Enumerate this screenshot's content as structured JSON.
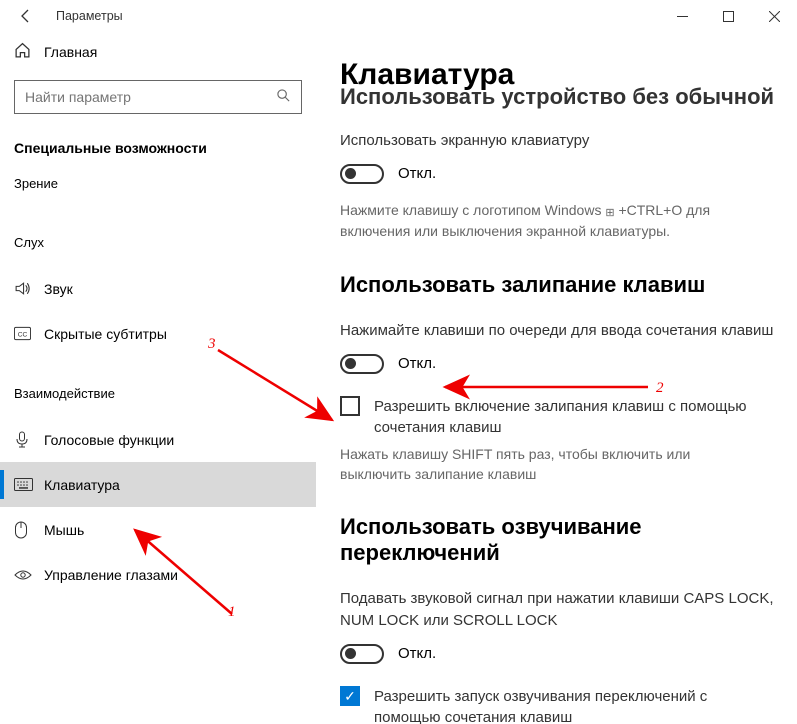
{
  "window": {
    "title": "Параметры"
  },
  "sidebar": {
    "home": "Главная",
    "search_placeholder": "Найти параметр",
    "section": "Специальные возможности",
    "group_vision": "Зрение",
    "group_hearing": "Слух",
    "items_hearing": [
      {
        "icon": "sound-icon",
        "label": "Звук"
      },
      {
        "icon": "cc-icon",
        "label": "Скрытые субтитры"
      }
    ],
    "group_interaction": "Взаимодействие",
    "items_interaction": [
      {
        "icon": "mic-icon",
        "label": "Голосовые функции"
      },
      {
        "icon": "keyboard-icon",
        "label": "Клавиатура"
      },
      {
        "icon": "mouse-icon",
        "label": "Мышь"
      },
      {
        "icon": "eye-icon",
        "label": "Управление глазами"
      }
    ]
  },
  "page": {
    "title": "Клавиатура",
    "clipped_h": "Использовать устройство без обычной клавиатуры",
    "osk_desc": "Использовать экранную клавиатуру",
    "off": "Откл.",
    "osk_hint_pre": "Нажмите клавишу с логотипом Windows ",
    "osk_hint_post": " +CTRL+O для включения или выключения экранной клавиатуры.",
    "sticky_h": "Использовать залипание клавиш",
    "sticky_desc": "Нажимайте клавиши по очереди для ввода сочетания клавиш",
    "sticky_cb": "Разрешить включение залипания клавиш с помощью сочетания клавиш",
    "sticky_cb_hint": "Нажать клавишу SHIFT пять раз, чтобы включить или выключить залипание клавиш",
    "toggle_h": "Использовать озвучивание переключений",
    "toggle_desc": "Подавать звуковой сигнал при нажатии клавиши CAPS LOCK, NUM LOCK или SCROLL LOCK",
    "toggle_cb": "Разрешить запуск озвучивания переключений с помощью сочетания клавиш"
  },
  "annotations": {
    "a1": "1",
    "a2": "2",
    "a3": "3"
  }
}
